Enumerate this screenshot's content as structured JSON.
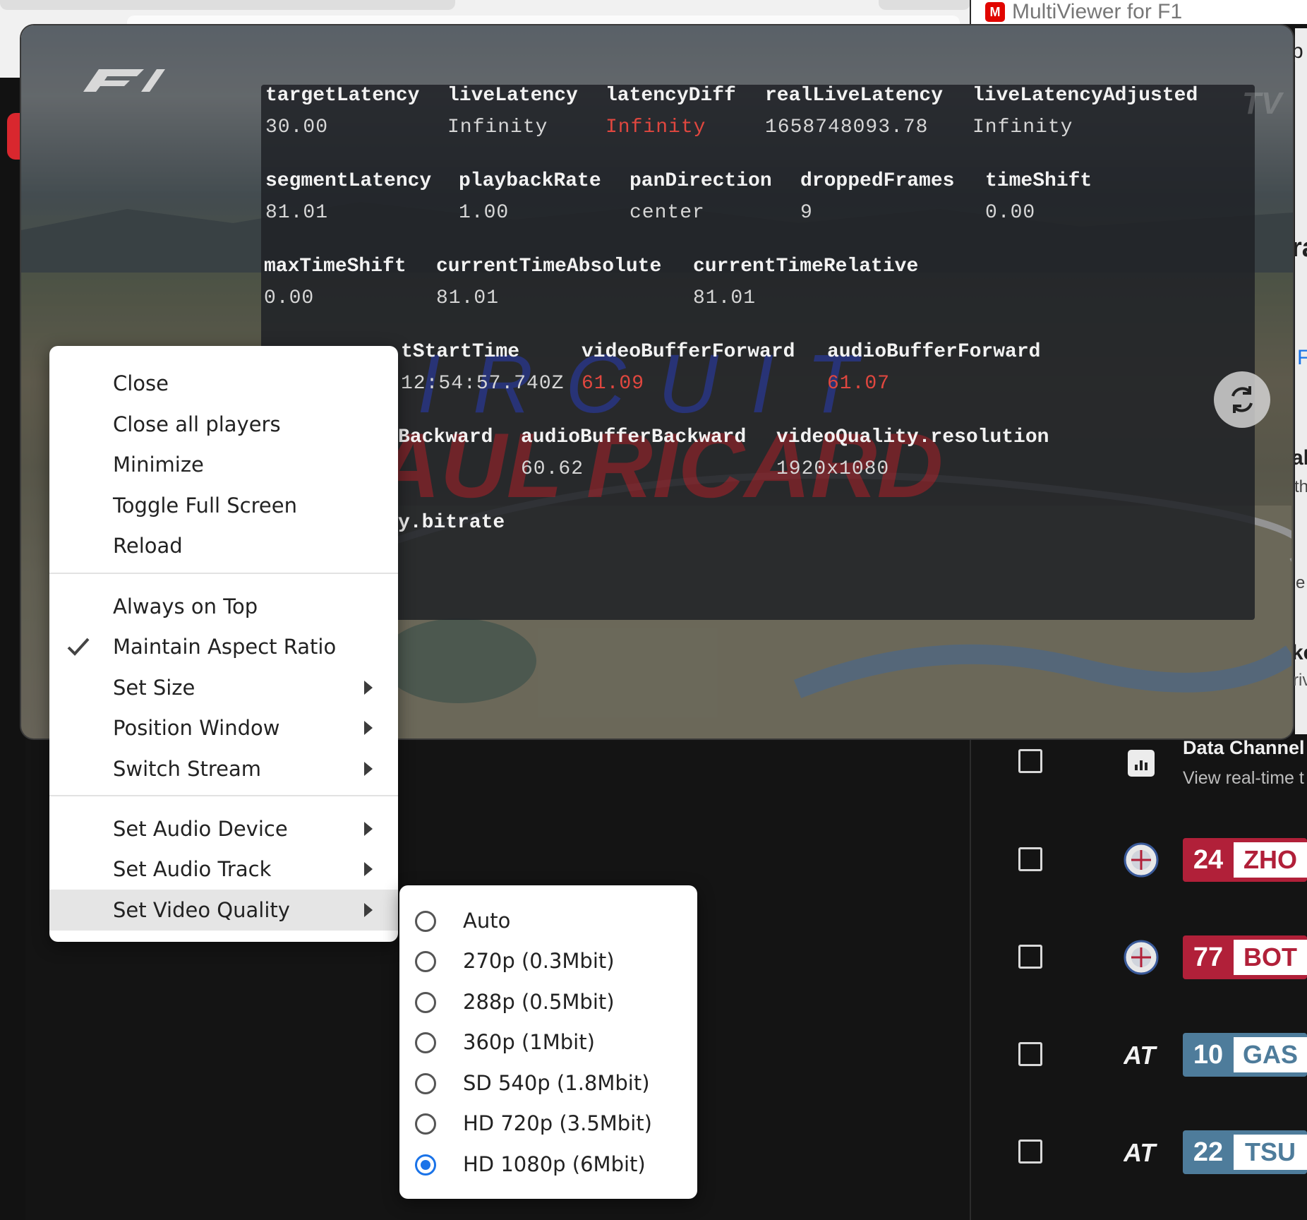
{
  "app": {
    "title": "MultiViewer for F1"
  },
  "player": {
    "stats": [
      {
        "key": "targetLatency",
        "value": "30.00",
        "alert": false
      },
      {
        "key": "liveLatency",
        "value": "Infinity",
        "alert": false
      },
      {
        "key": "latencyDiff",
        "value": "Infinity",
        "alert": true
      },
      {
        "key": "realLiveLatency",
        "value": "1658748093.78",
        "alert": false
      },
      {
        "key": "liveLatencyAdjusted",
        "value": "Infinity",
        "alert": false
      },
      {
        "key": "segmentLatency",
        "value": "81.01",
        "alert": false
      },
      {
        "key": "playbackRate",
        "value": "1.00",
        "alert": false
      },
      {
        "key": "panDirection",
        "value": "center",
        "alert": false
      },
      {
        "key": "droppedFrames",
        "value": "9",
        "alert": false
      },
      {
        "key": "timeShift",
        "value": "0.00",
        "alert": false
      },
      {
        "key": "maxTimeShift",
        "value": "0.00",
        "alert": false
      },
      {
        "key": "currentTimeAbsolute",
        "value": "81.01",
        "alert": false
      },
      {
        "key": "currentTimeRelative",
        "value": "81.01",
        "alert": false
      },
      {
        "key": "tStartTime",
        "value": "12:54:57.740Z",
        "alert": false
      },
      {
        "key": "videoBufferForward",
        "value": "61.09",
        "alert": true
      },
      {
        "key": "audioBufferForward",
        "value": "61.07",
        "alert": true
      },
      {
        "key": "Backward",
        "value": "",
        "alert": false
      },
      {
        "key": "audioBufferBackward",
        "value": "60.62",
        "alert": false
      },
      {
        "key": "videoQuality.resolution",
        "value": "1920x1080",
        "alert": false
      },
      {
        "key": "y.bitrate",
        "value": "",
        "alert": false
      }
    ],
    "overlay_text": {
      "circuit": "CIRCUIT",
      "paul": "AUL RICARD",
      "tv": "TV"
    }
  },
  "context_menu": {
    "items": [
      {
        "label": "Close",
        "submenu": false,
        "checked": false
      },
      {
        "label": "Close all players",
        "submenu": false,
        "checked": false
      },
      {
        "label": "Minimize",
        "submenu": false,
        "checked": false
      },
      {
        "label": "Toggle Full Screen",
        "submenu": false,
        "checked": false
      },
      {
        "label": "Reload",
        "submenu": false,
        "checked": false
      },
      {
        "label": "Always on Top",
        "submenu": false,
        "checked": false
      },
      {
        "label": "Maintain Aspect Ratio",
        "submenu": false,
        "checked": true
      },
      {
        "label": "Set Size",
        "submenu": true,
        "checked": false
      },
      {
        "label": "Position Window",
        "submenu": true,
        "checked": false
      },
      {
        "label": "Switch Stream",
        "submenu": true,
        "checked": false
      },
      {
        "label": "Set Audio Device",
        "submenu": true,
        "checked": false
      },
      {
        "label": "Set Audio Track",
        "submenu": true,
        "checked": false
      },
      {
        "label": "Set Video Quality",
        "submenu": true,
        "checked": false,
        "highlighted": true
      }
    ]
  },
  "video_quality_menu": {
    "options": [
      {
        "label": "Auto",
        "selected": false
      },
      {
        "label": "270p (0.3Mbit)",
        "selected": false
      },
      {
        "label": "288p (0.5Mbit)",
        "selected": false
      },
      {
        "label": "360p (1Mbit)",
        "selected": false
      },
      {
        "label": "SD 540p (1.8Mbit)",
        "selected": false
      },
      {
        "label": "HD 720p (3.5Mbit)",
        "selected": false
      },
      {
        "label": "HD 1080p (6Mbit)",
        "selected": true
      }
    ]
  },
  "right_panel": {
    "edge_fragments": [
      "p",
      "ra",
      "F",
      "al",
      "th",
      "e",
      "ke",
      "riv"
    ],
    "data_channel": {
      "title": "Data Channel",
      "description": "View real-time t",
      "icon": "bar-chart-icon"
    },
    "drivers": [
      {
        "number": "24",
        "code": "ZHO",
        "team_icon": "alfa-romeo-icon",
        "color": "#b12039"
      },
      {
        "number": "77",
        "code": "BOT",
        "team_icon": "alfa-romeo-icon",
        "color": "#b12039"
      },
      {
        "number": "10",
        "code": "GAS",
        "team_icon": "alphatauri-icon",
        "color": "#4e7c9b"
      },
      {
        "number": "22",
        "code": "TSU",
        "team_icon": "alphatauri-icon",
        "color": "#4e7c9b"
      }
    ]
  },
  "colors": {
    "alert_red": "#e0473f",
    "radio_selected": "#1a73e8",
    "app_logo": "#e10600"
  }
}
